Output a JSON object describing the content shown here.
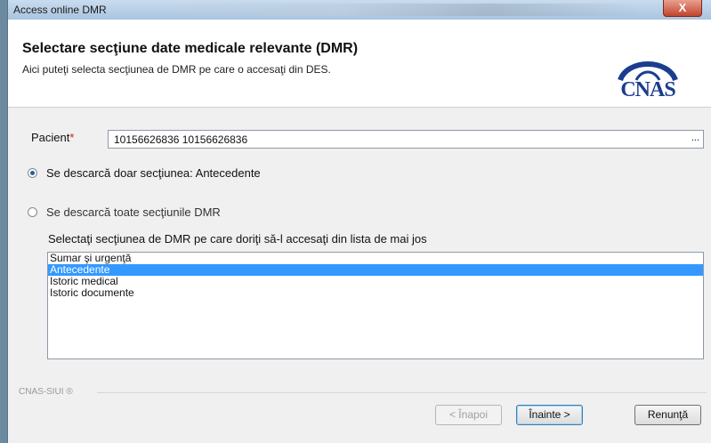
{
  "window": {
    "title": "Access online DMR",
    "close_label": "X"
  },
  "header": {
    "title": "Selectare secţiune date medicale relevante (DMR)",
    "subtitle": "Aici puteţi selecta secţiunea de DMR pe care o accesaţi din DES.",
    "logo_text": "CNAS"
  },
  "patient": {
    "label": "Pacient",
    "required_mark": "*",
    "value": "10156626836 10156626836",
    "browse_label": "..."
  },
  "options": {
    "single_label": "Se descarcă doar secţiunea: Antecedente",
    "single_selected": true,
    "all_label": "Se descarcă toate secţiunile DMR",
    "all_selected": false
  },
  "section_list": {
    "prompt": "Selectaţi secţiunea de DMR pe care doriţi să-l accesaţi din lista de mai jos",
    "items": [
      "Sumar şi urgenţă",
      "Antecedente",
      "Istoric medical",
      "Istoric documente"
    ],
    "selected_index": 1
  },
  "footer": {
    "brand": "CNAS-SIUI ®",
    "back_label": "< Înapoi",
    "next_label": "Înainte >",
    "cancel_label": "Renunţă"
  }
}
